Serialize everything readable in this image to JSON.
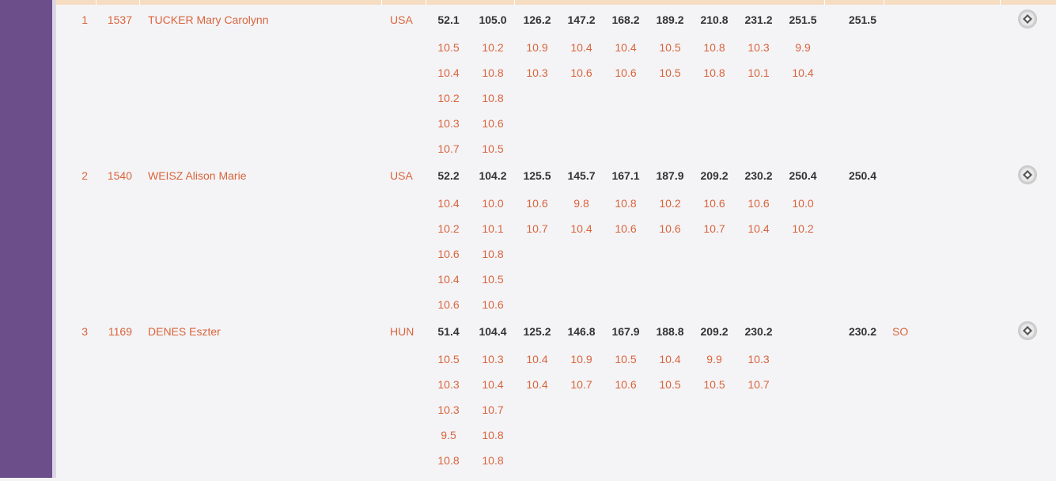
{
  "results": [
    {
      "rank": "1",
      "bib": "1537",
      "name": "TUCKER Mary Carolynn",
      "nation": "USA",
      "series": [
        "52.1",
        "105.0",
        "126.2",
        "147.2",
        "168.2",
        "189.2",
        "210.8",
        "231.2",
        "251.5"
      ],
      "total": "251.5",
      "remarks": "",
      "shots": [
        [
          "10.5",
          "10.4",
          "10.2",
          "10.3",
          "10.7"
        ],
        [
          "10.2",
          "10.8",
          "10.8",
          "10.6",
          "10.5"
        ],
        [
          "10.9",
          "10.3"
        ],
        [
          "10.4",
          "10.6"
        ],
        [
          "10.4",
          "10.6"
        ],
        [
          "10.5",
          "10.5"
        ],
        [
          "10.8",
          "10.8"
        ],
        [
          "10.3",
          "10.1"
        ],
        [
          "9.9",
          "10.4"
        ]
      ],
      "target_icon": "target-icon"
    },
    {
      "rank": "2",
      "bib": "1540",
      "name": "WEISZ Alison Marie",
      "nation": "USA",
      "series": [
        "52.2",
        "104.2",
        "125.5",
        "145.7",
        "167.1",
        "187.9",
        "209.2",
        "230.2",
        "250.4"
      ],
      "total": "250.4",
      "remarks": "",
      "shots": [
        [
          "10.4",
          "10.2",
          "10.6",
          "10.4",
          "10.6"
        ],
        [
          "10.0",
          "10.1",
          "10.8",
          "10.5",
          "10.6"
        ],
        [
          "10.6",
          "10.7"
        ],
        [
          "9.8",
          "10.4"
        ],
        [
          "10.8",
          "10.6"
        ],
        [
          "10.2",
          "10.6"
        ],
        [
          "10.6",
          "10.7"
        ],
        [
          "10.6",
          "10.4"
        ],
        [
          "10.0",
          "10.2"
        ]
      ],
      "target_icon": "target-icon"
    },
    {
      "rank": "3",
      "bib": "1169",
      "name": "DENES Eszter",
      "nation": "HUN",
      "series": [
        "51.4",
        "104.4",
        "125.2",
        "146.8",
        "167.9",
        "188.8",
        "209.2",
        "230.2",
        ""
      ],
      "total": "230.2",
      "remarks": "SO",
      "shots": [
        [
          "10.5",
          "10.3",
          "10.3",
          "9.5",
          "10.8"
        ],
        [
          "10.3",
          "10.4",
          "10.7",
          "10.8",
          "10.8"
        ],
        [
          "10.4",
          "10.4"
        ],
        [
          "10.9",
          "10.7"
        ],
        [
          "10.5",
          "10.6"
        ],
        [
          "10.4",
          "10.5"
        ],
        [
          "9.9",
          "10.5"
        ],
        [
          "10.3",
          "10.7"
        ],
        []
      ],
      "target_icon": "target-icon"
    }
  ]
}
